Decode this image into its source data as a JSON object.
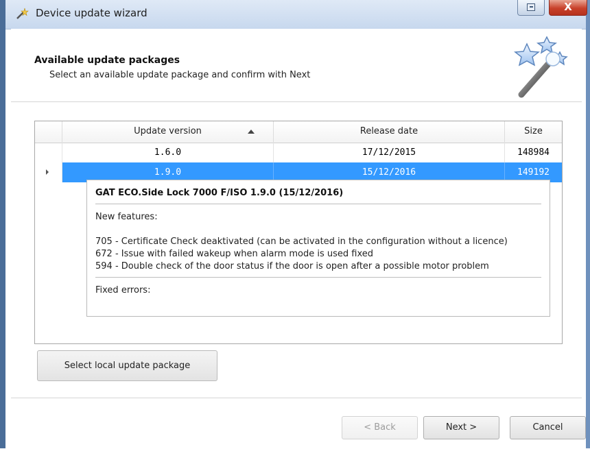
{
  "window": {
    "title": "Device update wizard",
    "close_glyph": "X"
  },
  "header": {
    "title": "Available update packages",
    "subtitle": "Select an available update package and confirm with Next",
    "icon": "magic-wand-stars-icon"
  },
  "grid": {
    "columns": [
      "Update version",
      "Release date",
      "Size"
    ],
    "sort": {
      "column": "Update version",
      "direction": "ascending"
    },
    "rows": [
      {
        "version": "1.6.0",
        "date": "17/12/2015",
        "size": "148984",
        "selected": false
      },
      {
        "version": "1.9.0",
        "date": "15/12/2016",
        "size": "149192",
        "selected": true
      }
    ],
    "selection_color": "#3399ff"
  },
  "detail": {
    "title": "GAT ECO.Side Lock 7000 F/ISO 1.9.0 (15/12/2016)",
    "new_features_label": "New features:",
    "features": [
      "705 - Certificate Check deaktivated (can be activated in the configuration without a licence)",
      "672 - Issue with failed wakeup when alarm mode is used fixed",
      "594 - Double check of the door status if the door is open after a possible motor problem"
    ],
    "fixed_errors_label": "Fixed errors:"
  },
  "buttons": {
    "local_package": "Select local update package",
    "back": "< Back",
    "next": "Next >",
    "cancel": "Cancel"
  }
}
